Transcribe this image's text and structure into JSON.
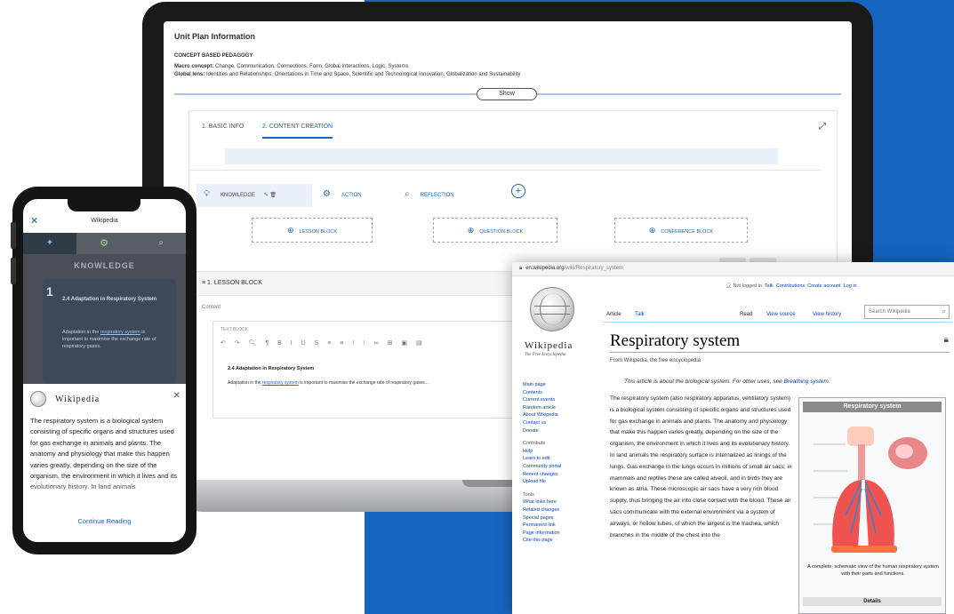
{
  "laptop": {
    "unit_header": "Unit Plan Information",
    "pedagogy_heading": "CONCEPT BASED PEDAGOGY",
    "macro_label": "Macro concept:",
    "macro_value": "Change, Communication, Connections, Form, Global Interactions, Logic, Systems",
    "lens_label": "Global lens:",
    "lens_value": "Identities and Relationships, Orientations in Time and Space, Scientific and Technological Innovation, Globalization and Sustainability",
    "show_label": "Show",
    "tabs": [
      "1. BASIC INFO",
      "2. CONTENT CREATION"
    ],
    "phases": [
      "KNOWLEDGE",
      "ACTION",
      "REFLECTION"
    ],
    "block_buttons": [
      "LESSON BLOCK",
      "QUESTION BLOCK",
      "CONFERENCE BLOCK"
    ],
    "lesson_bar": "1. LESSON BLOCK",
    "content_label": "Content",
    "editor_title": "TEXT BLOCK",
    "editor_heading": "2.4 Adaptation in Respiratory System",
    "editor_text_pre": "Adaptation in the",
    "editor_text_link": "respiratory system",
    "editor_text_post": "is important to maximise the exchange rate of respiratory gases..."
  },
  "phone": {
    "header_title": "Wikipedia",
    "section_title": "KNOWLEDGE",
    "card_number": "1",
    "card_title": "2.4 Adaptation in Respiratory System",
    "card_text_pre": "Adaptation in the",
    "card_text_link": "respiratory system",
    "card_text_post": "is important to maximise the exchange rate of respiratory gases.",
    "wiki_wordmark": "Wikipedia",
    "popup_text": "The respiratory system is a biological system consisting of specific organs and structures used for gas exchange in animals and plants. The anatomy and physiology that make this happen varies greatly, depending on the size of the organism, the environment in which it lives and its evolutionary history. In land animals",
    "continue_label": "Continue Reading"
  },
  "wiki": {
    "url_domain": "en.wikipedia.org",
    "url_path": "/wiki/Respiratory_system",
    "top_links": [
      "Not logged in",
      "Talk",
      "Contributions",
      "Create account",
      "Log in"
    ],
    "tabs": [
      "Article",
      "Talk",
      "Read",
      "View source",
      "View history"
    ],
    "search_placeholder": "Search Wikipedia",
    "wordmark": "Wikipedia",
    "tagline": "The Free Encyclopedia",
    "sidebar": [
      "Main page",
      "Contents",
      "Current events",
      "Random article",
      "About Wikipedia",
      "Contact us",
      "Donate"
    ],
    "contribute_heading": "Contribute",
    "contribute_items": [
      "Help",
      "Learn to edit",
      "Community portal",
      "Recent changes",
      "Upload file"
    ],
    "tools_heading": "Tools",
    "tools_items": [
      "What links here",
      "Related changes",
      "Special pages",
      "Permanent link",
      "Page information",
      "Cite this page"
    ],
    "title": "Respiratory system",
    "from": "From Wikipedia, the free encyclopedia",
    "hatnote_pre": "This article is about the biological system. For other uses, see",
    "hatnote_link": "Breathing system.",
    "body": "The respiratory system (also respiratory apparatus, ventilatory system) is a biological system consisting of specific organs and structures used for gas exchange in animals and plants. The anatomy and physiology that make this happen varies greatly, depending on the size of the organism, the environment in which it lives and its evolutionary history. In land animals the respiratory surface is internalized as linings of the lungs. Gas exchange in the lungs occurs in millions of small air sacs; in mammals and reptiles these are called alveoli, and in birds they are known as atria. These microscopic air sacs have a very rich blood supply, thus bringing the air into close contact with the blood. These air sacs communicate with the external environment via a system of airways, or hollow tubes, of which the largest is the trachea, which branches in the middle of the chest into the",
    "infobox_title": "Respiratory system",
    "infobox_caption": "A complete, schematic view of the human respiratory system with their parts and functions.",
    "infobox_details": "Details"
  },
  "colors": {
    "accent": "#1e63c4",
    "background_blue": "#1565c0",
    "wiki_link": "#0645ad"
  }
}
